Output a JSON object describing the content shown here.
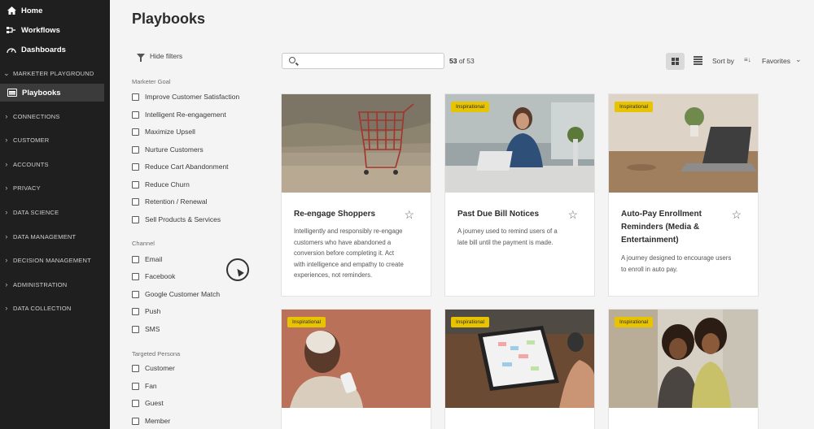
{
  "sidebar": {
    "top_items": [
      {
        "label": "Home",
        "icon": "home-icon"
      },
      {
        "label": "Workflows",
        "icon": "workflow-icon"
      },
      {
        "label": "Dashboards",
        "icon": "dashboard-icon"
      }
    ],
    "sections": [
      "MARKETER PLAYGROUND",
      "CONNECTIONS",
      "CUSTOMER",
      "ACCOUNTS",
      "PRIVACY",
      "DATA SCIENCE",
      "DATA MANAGEMENT",
      "DECISION MANAGEMENT",
      "ADMINISTRATION",
      "DATA COLLECTION"
    ],
    "active_item": "Playbooks"
  },
  "header": {
    "title": "Playbooks"
  },
  "filters": {
    "hide_label": "Hide filters",
    "groups": [
      {
        "title": "Marketer Goal",
        "items": [
          "Improve Customer Satisfaction",
          "Intelligent Re-engagement",
          "Maximize Upsell",
          "Nurture Customers",
          "Reduce Cart Abandonment",
          "Reduce Churn",
          "Retention / Renewal",
          "Sell Products & Services"
        ]
      },
      {
        "title": "Channel",
        "items": [
          "Email",
          "Facebook",
          "Google Customer Match",
          "Push",
          "SMS"
        ]
      },
      {
        "title": "Targeted Persona",
        "items": [
          "Customer",
          "Fan",
          "Guest",
          "Member"
        ]
      }
    ]
  },
  "toolbar": {
    "search_value": "",
    "count_current": "53",
    "count_text": " of 53",
    "sort_label": "Sort by",
    "sort_value": "Favorites"
  },
  "cards": [
    {
      "title": "Re-engage Shoppers",
      "badge": "",
      "description_lines": [
        "Intelligently and responsibly re-engage",
        "customers who have abandoned a",
        "conversion before completing it. Act",
        "with intelligence and empathy to create",
        "experiences, not reminders."
      ]
    },
    {
      "title": "Past Due Bill Notices",
      "badge": "Inspirational",
      "description_lines": [
        "A journey used to remind users of a",
        "late bill until the payment is made."
      ]
    },
    {
      "title_lines": [
        "Auto-Pay Enrollment",
        "Reminders (Media &",
        "Entertainment)"
      ],
      "badge": "Inspirational",
      "description_lines": [
        "A journey designed to encourage users",
        "to enroll in auto pay."
      ]
    },
    {
      "badge": "Inspirational"
    },
    {
      "badge": "Inspirational"
    },
    {
      "badge": "Inspirational"
    }
  ],
  "colors": {
    "sidebar_bg": "#1f1f1f",
    "sidebar_active": "#3b3b3b",
    "badge": "#e8c400",
    "page_bg": "#f4f4f4"
  }
}
